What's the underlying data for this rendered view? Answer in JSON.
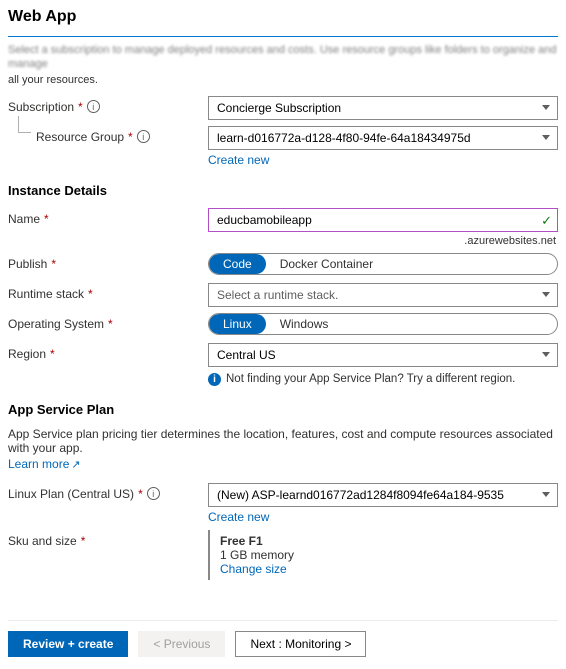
{
  "page": {
    "title": "Web App",
    "blurred_line": "Select a subscription to manage deployed resources and costs. Use resource groups like folders to organize and manage",
    "blurred_tail": "all your resources."
  },
  "basics": {
    "subscription_label": "Subscription",
    "subscription_value": "Concierge Subscription",
    "resource_group_label": "Resource Group",
    "resource_group_value": "learn-d016772a-d128-4f80-94fe-64a18434975d",
    "create_new": "Create new"
  },
  "instance": {
    "section": "Instance Details",
    "name_label": "Name",
    "name_value": "educbamobileapp",
    "name_suffix": ".azurewebsites.net",
    "publish_label": "Publish",
    "publish_code": "Code",
    "publish_docker": "Docker Container",
    "runtime_label": "Runtime stack",
    "runtime_placeholder": "Select a runtime stack.",
    "os_label": "Operating System",
    "os_linux": "Linux",
    "os_windows": "Windows",
    "region_label": "Region",
    "region_value": "Central US",
    "region_hint": "Not finding your App Service Plan? Try a different region."
  },
  "plan": {
    "section": "App Service Plan",
    "desc": "App Service plan pricing tier determines the location, features, cost and compute resources associated with your app.",
    "learn_more": "Learn more",
    "linux_plan_label": "Linux Plan (Central US)",
    "linux_plan_value": "(New) ASP-learnd016772ad1284f8094fe64a184-9535",
    "create_new": "Create new",
    "sku_label": "Sku and size",
    "sku_name": "Free F1",
    "sku_detail": "1 GB memory",
    "sku_change": "Change size"
  },
  "footer": {
    "review": "Review + create",
    "previous": "< Previous",
    "next": "Next : Monitoring >"
  }
}
